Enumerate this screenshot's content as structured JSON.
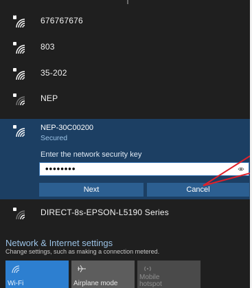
{
  "networks": [
    {
      "name": "676767676"
    },
    {
      "name": "803"
    },
    {
      "name": "35-202"
    },
    {
      "name": "NEP"
    }
  ],
  "selected_network": {
    "name": "NEP-30C00200",
    "status": "Secured",
    "prompt": "Enter the network security key",
    "password_mask": "••••••••",
    "next_label": "Next",
    "cancel_label": "Cancel"
  },
  "other_network": {
    "name": "DIRECT-8s-EPSON-L5190 Series"
  },
  "settings": {
    "title": "Network & Internet settings",
    "subtitle": "Change settings, such as making a connection metered."
  },
  "quick_actions": {
    "wifi": "Wi-Fi",
    "airplane": "Airplane mode",
    "hotspot_line1": "Mobile",
    "hotspot_line2": "hotspot"
  },
  "colors": {
    "background": "#1f1f1f",
    "selected_bg": "#1c3f63",
    "button_bg": "#2c5f91",
    "accent_tile": "#2d7fd0",
    "link": "#9cc3e6",
    "annotation": "#e0202a"
  }
}
